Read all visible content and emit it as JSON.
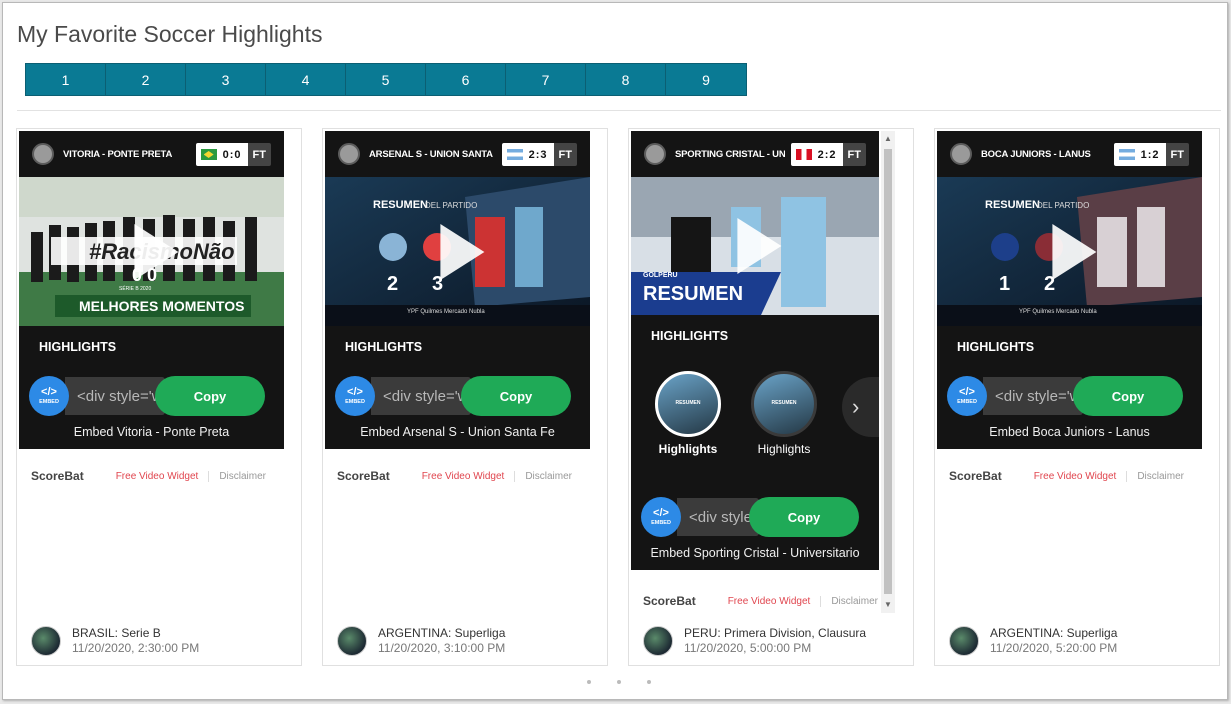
{
  "page": {
    "title": "My Favorite Soccer Highlights"
  },
  "pager": [
    "1",
    "2",
    "3",
    "4",
    "5",
    "6",
    "7",
    "8",
    "9"
  ],
  "common": {
    "highlights_label": "HIGHLIGHTS",
    "copy_label": "Copy",
    "embed_code": "<div style='w",
    "embed_code_short": "<div style=",
    "embed_icon_code": "</>",
    "embed_icon_label": "EMBED",
    "brand": "ScoreBat",
    "free_widget": "Free Video Widget",
    "disclaimer": "Disclaimer",
    "ft": "FT"
  },
  "cards": [
    {
      "match": "VITORIA - PONTE PRETA",
      "score": "0:0",
      "flag": "br",
      "embed_title": "Embed Vitoria - Ponte Preta",
      "league": "BRASIL: Serie B",
      "date": "11/20/2020, 2:30:00 PM",
      "thumb": {
        "overlay": "#RacismoNão",
        "score": "0 0",
        "caption": "MELHORES MOMENTOS",
        "series": "SÉRIE B 2020"
      }
    },
    {
      "match": "ARSENAL S - UNION SANTA FE",
      "score": "2:3",
      "flag": "ar",
      "embed_title": "Embed Arsenal S - Union Santa Fe",
      "league": "ARGENTINA: Superliga",
      "date": "11/20/2020, 3:10:00 PM",
      "thumb": {
        "resumen": "RESUMEN",
        "partido": "DEL PARTIDO",
        "home": "2",
        "away": "3",
        "sponsors": "YPF  Quilmes  Mercado  Nubla"
      }
    },
    {
      "match": "SPORTING CRISTAL - UNIVERSITARIO",
      "score": "2:2",
      "flag": "pe",
      "embed_title": "Embed Sporting Cristal - Universitario",
      "league": "PERU: Primera Division, Clausura",
      "date": "11/20/2020, 5:00:00 PM",
      "thumb": {
        "golperu": "GOLPERU",
        "resumen": "RESUMEN"
      },
      "carousel": [
        {
          "label": "Highlights",
          "tag": "RESUMEN"
        },
        {
          "label": "Highlights",
          "tag": "RESUMEN"
        }
      ],
      "carousel_next": "›"
    },
    {
      "match": "BOCA JUNIORS - LANUS",
      "score": "1:2",
      "flag": "ar",
      "embed_title": "Embed Boca Juniors - Lanus",
      "league": "ARGENTINA: Superliga",
      "date": "11/20/2020, 5:20:00 PM",
      "thumb": {
        "resumen": "RESUMEN",
        "partido": "DEL PARTIDO",
        "home": "1",
        "away": "2",
        "sponsors": "YPF  Quilmes  Mercado  Nubla"
      }
    }
  ],
  "scroll_arrows": {
    "up": "▲",
    "down": "▼"
  }
}
